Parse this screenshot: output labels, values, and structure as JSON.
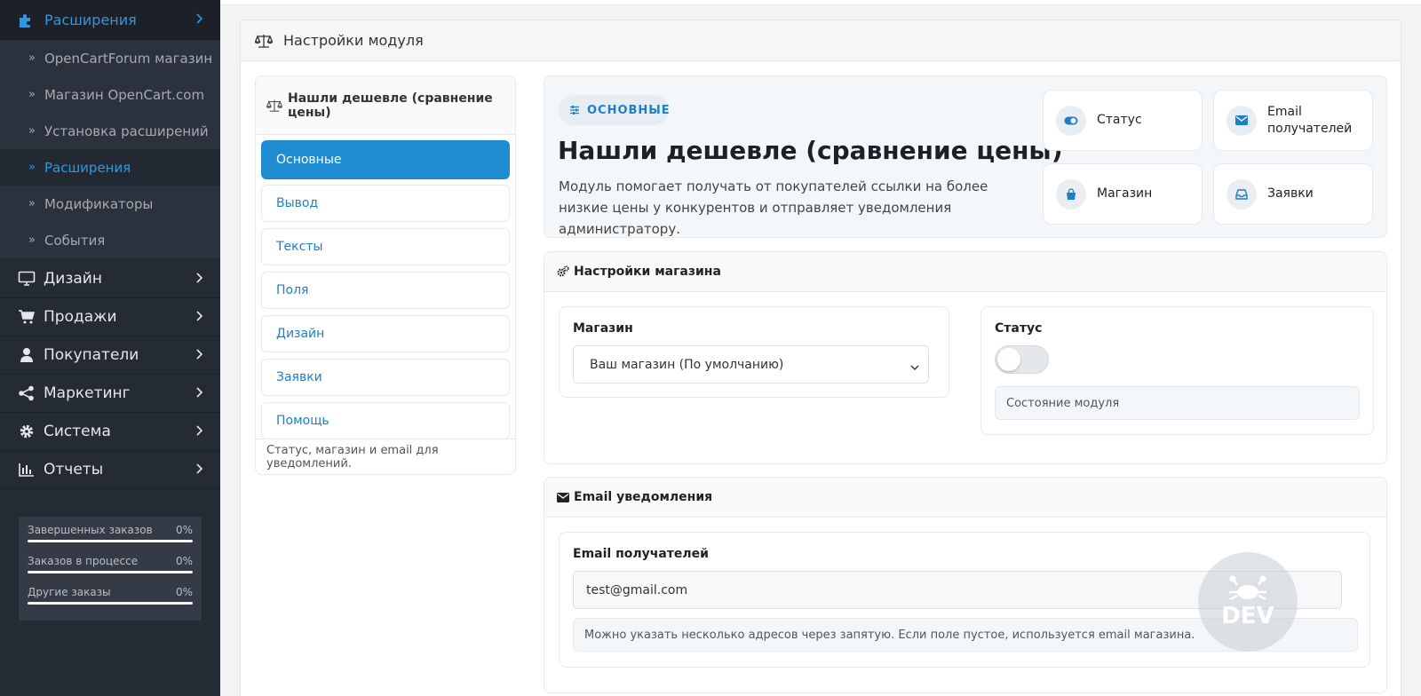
{
  "sidebar": {
    "active_item": {
      "label": "Расширения",
      "icon": "puzzle-icon"
    },
    "sub_items": [
      {
        "label": "OpenCartForum магазин"
      },
      {
        "label": "Магазин OpenCart.com"
      },
      {
        "label": "Установка расширений"
      },
      {
        "label": "Расширения"
      },
      {
        "label": "Модификаторы"
      },
      {
        "label": "События"
      }
    ],
    "items": [
      {
        "label": "Дизайн",
        "icon": "monitor-icon"
      },
      {
        "label": "Продажи",
        "icon": "cart-icon"
      },
      {
        "label": "Покупатели",
        "icon": "user-icon"
      },
      {
        "label": "Маркетинг",
        "icon": "share-icon"
      },
      {
        "label": "Система",
        "icon": "gear-icon"
      },
      {
        "label": "Отчеты",
        "icon": "bar-chart-icon"
      }
    ],
    "stats": [
      {
        "label": "Завершенных заказов",
        "value": "0%",
        "progress": 0
      },
      {
        "label": "Заказов в процессе",
        "value": "0%",
        "progress": 0
      },
      {
        "label": "Другие заказы",
        "value": "0%",
        "progress": 0
      }
    ]
  },
  "page": {
    "title": "Настройки модуля",
    "title_icon": "balance-scale-icon"
  },
  "nav": {
    "title": "Нашли дешевле (сравнение цены)",
    "tabs": [
      {
        "label": "Основные",
        "active": true
      },
      {
        "label": "Вывод"
      },
      {
        "label": "Тексты"
      },
      {
        "label": "Поля"
      },
      {
        "label": "Дизайн"
      },
      {
        "label": "Заявки"
      },
      {
        "label": "Помощь"
      }
    ],
    "footer": "Статус, магазин и email для уведомлений."
  },
  "hero": {
    "pill": "ОСНОВНЫЕ",
    "title": "Нашли дешевле (сравнение цены)",
    "description": "Модуль помогает получать от покупателей ссылки на более низкие цены у конкурентов и отправляет уведомления администратору.",
    "quick_links": [
      {
        "label": "Статус",
        "icon": "toggle-icon"
      },
      {
        "label": "Email получателей",
        "icon": "envelope-icon"
      },
      {
        "label": "Магазин",
        "icon": "shopping-bag-icon"
      },
      {
        "label": "Заявки",
        "icon": "inbox-icon"
      }
    ]
  },
  "store_settings": {
    "title": "Настройки магазина",
    "store_label": "Магазин",
    "store_value": "Ваш магазин (По умолчанию)",
    "status_label": "Статус",
    "status_on": false,
    "status_hint": "Состояние модуля"
  },
  "email_settings": {
    "title": "Email уведомления",
    "label": "Email получателей",
    "value": "test@gmail.com",
    "hint": "Можно указать несколько адресов через запятую. Если поле пустое, используется email магазина."
  },
  "watermark": "DEV",
  "colors": {
    "accent": "#1f8bd0",
    "sidebar_bg": "#252b35",
    "sidebar_active": "#3097dd"
  }
}
